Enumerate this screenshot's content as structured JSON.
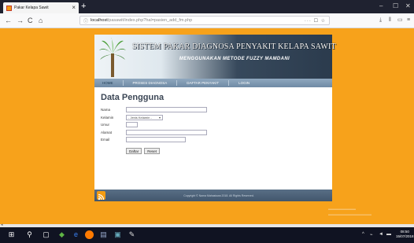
{
  "browser": {
    "tab_title": "Pakar Kelapa Sawit",
    "tab_close": "×",
    "new_tab": "+",
    "url_host": "localhost",
    "url_path": "/pasawit/index.php?hal=pasien_add_fm.php",
    "url_tail": "··· ☐ ☆",
    "back": "←",
    "forward": "→",
    "reload": "C",
    "home": "⌂",
    "win_min": "–",
    "win_max": "☐",
    "win_close": "✕"
  },
  "site": {
    "title": "SISTEM PAKAR DIAGNOSA PENYAKIT KELAPA SAWIT",
    "subtitle": "MENGGUNAKAN METODE FUZZY MAMDANI",
    "menu": [
      "HOME",
      "PROSES DIAGNOSA",
      "DAFTAR PENYAKIT",
      "LOGIN"
    ],
    "footer_text": "Copyright © Nama Mahasiswa 2018. All Rights Reserved."
  },
  "form": {
    "title": "Data Pengguna",
    "labels": {
      "nama": "Nama",
      "kelamin": "Kelamin",
      "umur": "Umur",
      "alamat": "Alamat",
      "email": "Email"
    },
    "kelamin_selected": "- Jenis Kelamin -",
    "buttons": {
      "daftar": "Daftar",
      "reset": "Reset"
    }
  },
  "taskbar": {
    "time": "08:50",
    "date": "15/07/2018"
  },
  "colors": {
    "page_bg": "#f7a21b",
    "header_dark": "#2b3b4d",
    "menu": "#7d97b0",
    "footer": "#4d6279"
  }
}
